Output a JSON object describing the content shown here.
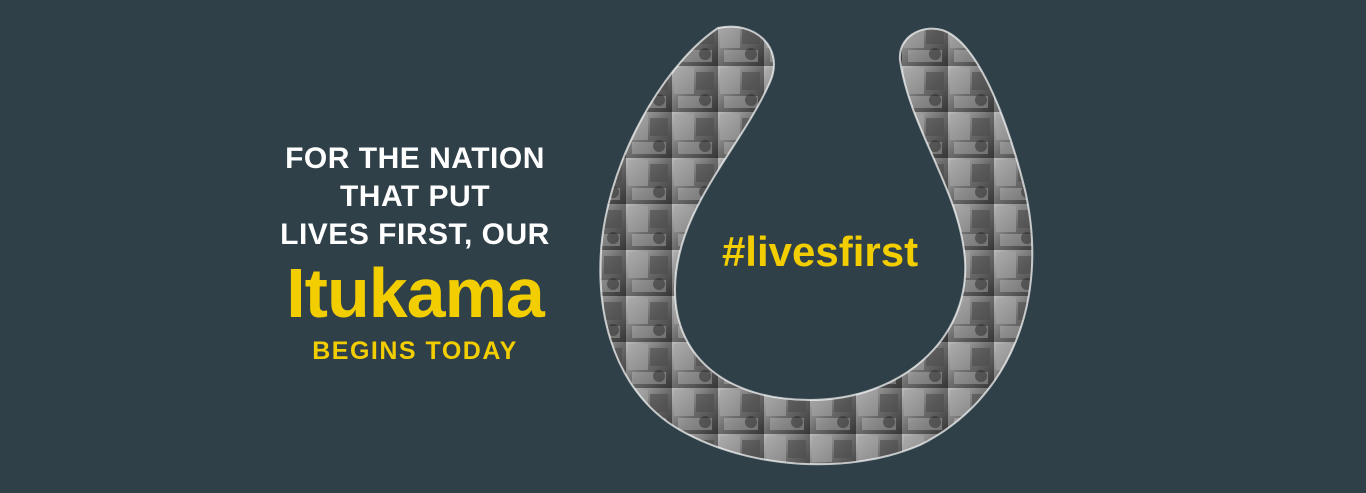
{
  "banner": {
    "headline_lines": [
      "FOR THE NATION",
      "THAT PUT",
      "LIVES FIRST, OUR"
    ],
    "brand": "Itukama",
    "subline": "BEGINS TODAY",
    "hashtag": "#livesfirst"
  },
  "colors": {
    "background": "#2f4048",
    "accent": "#f2cd00",
    "text": "#ffffff"
  },
  "collage": {
    "description_icon": "photo-collage-horseshoe"
  }
}
